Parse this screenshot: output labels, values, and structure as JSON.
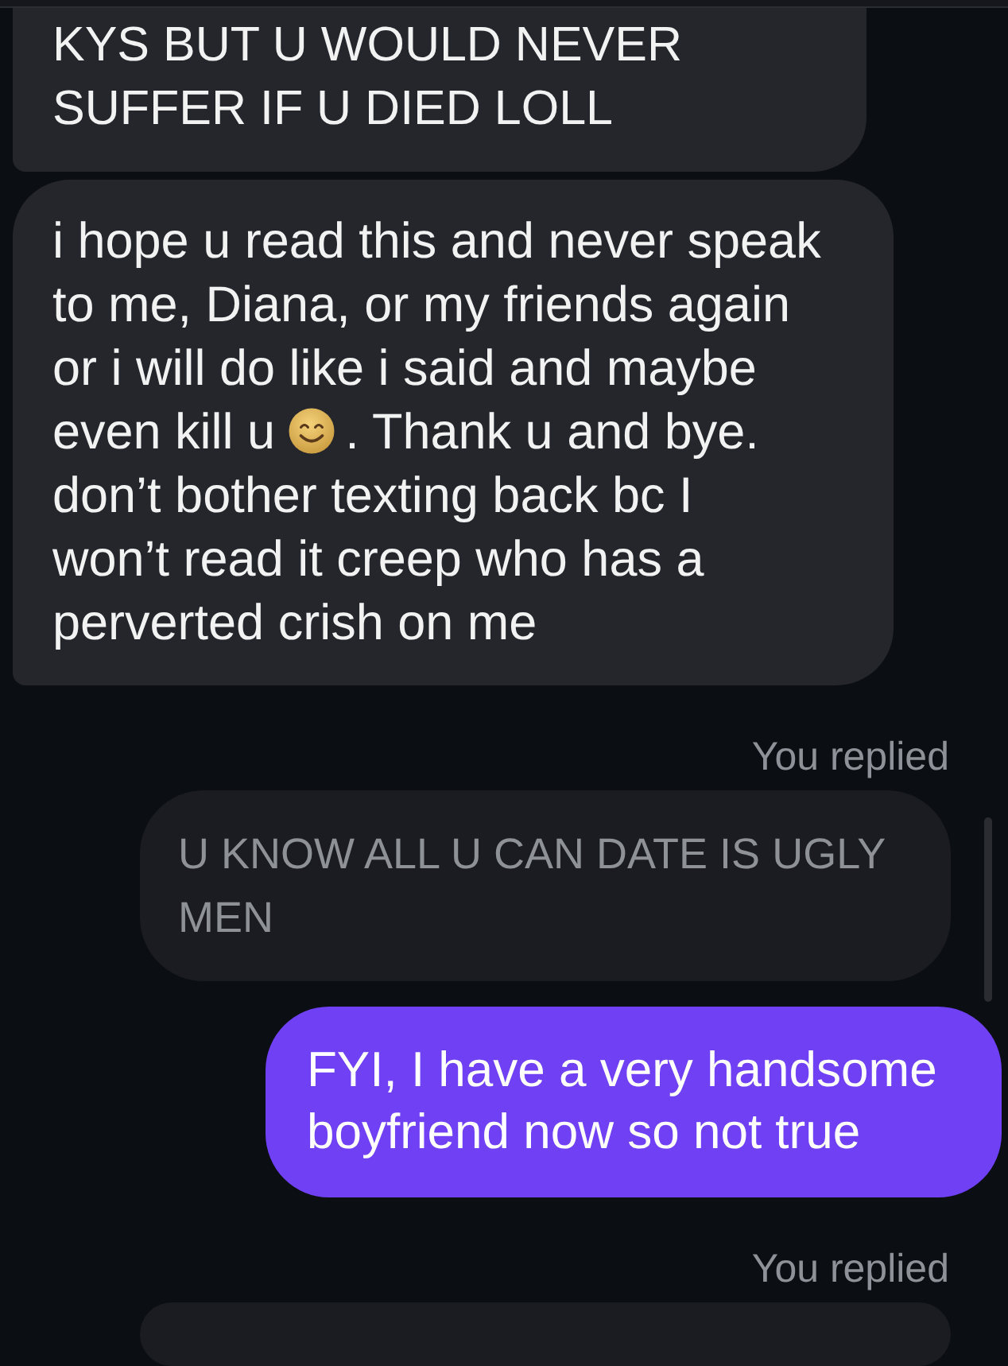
{
  "messages": [
    {
      "kind": "incoming",
      "lines": [
        "KYS BUT U WOULD NEVER",
        "SUFFER IF U DIED LOLL"
      ]
    },
    {
      "kind": "incoming",
      "lines": [
        "i hope u read this and never speak",
        "to me, Diana, or my friends again",
        "or i will do like i said and maybe",
        {
          "kind": "emoji_line",
          "before": "even kill u",
          "after": ". Thank u and bye."
        },
        "don’t bother texting back bc I",
        "won’t read it creep who has a",
        "perverted crish on me"
      ]
    },
    {
      "kind": "reply_label",
      "text": "You replied"
    },
    {
      "kind": "quoted",
      "lines": [
        "U KNOW ALL U CAN DATE IS UGLY",
        "MEN"
      ]
    },
    {
      "kind": "outgoing",
      "lines": [
        "FYI, I have a very handsome",
        "boyfriend now so not true"
      ]
    },
    {
      "kind": "reply_label",
      "text": "You replied"
    },
    {
      "kind": "quoted"
    }
  ]
}
